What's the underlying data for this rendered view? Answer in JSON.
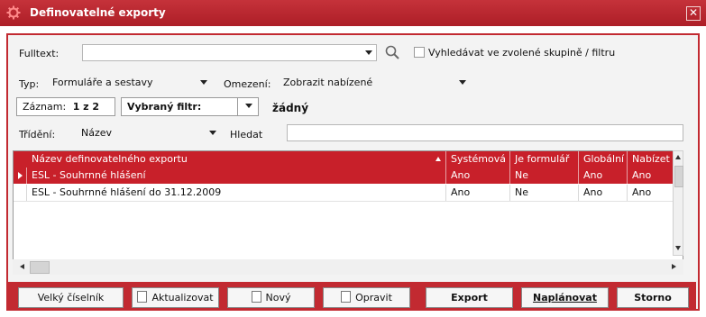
{
  "window": {
    "title": "Definovatelné exporty",
    "close_glyph": "✕"
  },
  "filters": {
    "fulltext_label": "Fulltext:",
    "fulltext_value": "",
    "search_in_group_label": "Vyhledávat ve zvolené skupině / filtru",
    "type_label": "Typ:",
    "type_value": "Formuláře a sestavy",
    "limit_label": "Omezení:",
    "limit_value": "Zobrazit nabízené",
    "records_label": "Záznam:",
    "records_value": "1 z 2",
    "selected_filter_label": "Vybraný filtr:",
    "selected_filter_value": "žádný",
    "sort_label": "Třídění:",
    "sort_value": "Název",
    "find_label": "Hledat",
    "find_value": ""
  },
  "table": {
    "columns": [
      "Název definovatelného exportu",
      "Systémová",
      "Je formulář",
      "Globální",
      "Nabízet"
    ],
    "rows": [
      {
        "name": "ESL - Souhrnné hlášení",
        "system": "Ano",
        "form": "Ne",
        "global": "Ano",
        "offer": "Ano",
        "selected": true
      },
      {
        "name": "ESL - Souhrnné hlášení do 31.12.2009",
        "system": "Ano",
        "form": "Ne",
        "global": "Ano",
        "offer": "Ano",
        "selected": false
      }
    ]
  },
  "buttons": {
    "big_codebook": "Velký číselník",
    "refresh": "Aktualizovat",
    "new": "Nový",
    "edit": "Opravit",
    "export": "Export",
    "schedule": "Naplánovat",
    "cancel": "Storno"
  },
  "colors": {
    "accent": "#c8202a",
    "title_bar": "#b0222a"
  },
  "icons": [
    "gear-icon",
    "close-icon",
    "search-icon",
    "chevron-down-icon",
    "sort-up-icon",
    "row-pointer-icon",
    "scroll-up-icon",
    "scroll-down-icon",
    "scroll-left-icon",
    "scroll-right-icon",
    "document-icon",
    "new-document-icon",
    "edit-icon"
  ]
}
